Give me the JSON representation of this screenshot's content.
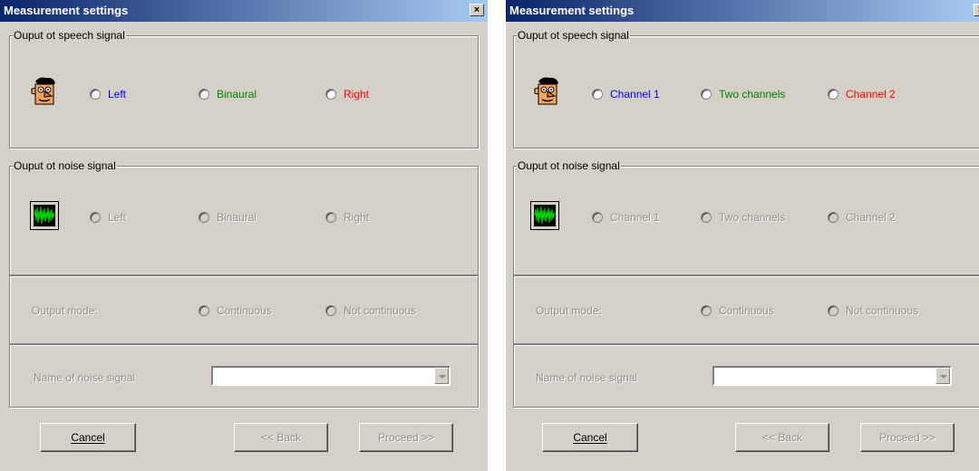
{
  "windows": [
    {
      "title": "Measurement settings",
      "close_label": "×",
      "speech_group": {
        "legend": "Ouput ot speech signal",
        "icon": "speaker-face-icon",
        "options": [
          "Left",
          "Binaural",
          "Right"
        ],
        "colors": [
          "#0000ff",
          "#008000",
          "#ff0000"
        ]
      },
      "noise_group": {
        "legend": "Ouput ot noise signal",
        "icon": "noise-waveform-icon",
        "options": [
          "Left",
          "Binaural",
          "Right"
        ]
      },
      "output_mode": {
        "label": "Output mode:",
        "options": [
          "Continuous",
          "Not continuous"
        ]
      },
      "noise_name": {
        "label": "Name of noise signal",
        "value": ""
      },
      "buttons": {
        "cancel": "Cancel",
        "back": "<< Back",
        "proceed": "Proceed >>"
      }
    },
    {
      "title": "Measurement settings",
      "close_label": "×",
      "speech_group": {
        "legend": "Ouput ot speech signal",
        "icon": "speaker-face-icon",
        "options": [
          "Channel 1",
          "Two channels",
          "Channel 2"
        ],
        "colors": [
          "#0000ff",
          "#008000",
          "#ff0000"
        ]
      },
      "noise_group": {
        "legend": "Ouput ot noise signal",
        "icon": "noise-waveform-icon",
        "options": [
          "Channel 1",
          "Two channels",
          "Channel 2"
        ]
      },
      "output_mode": {
        "label": "Output mode:",
        "options": [
          "Continuous",
          "Not continuous"
        ]
      },
      "noise_name": {
        "label": "Name of noise signal",
        "value": ""
      },
      "buttons": {
        "cancel": "Cancel",
        "back": "<< Back",
        "proceed": "Proceed >>"
      }
    }
  ]
}
